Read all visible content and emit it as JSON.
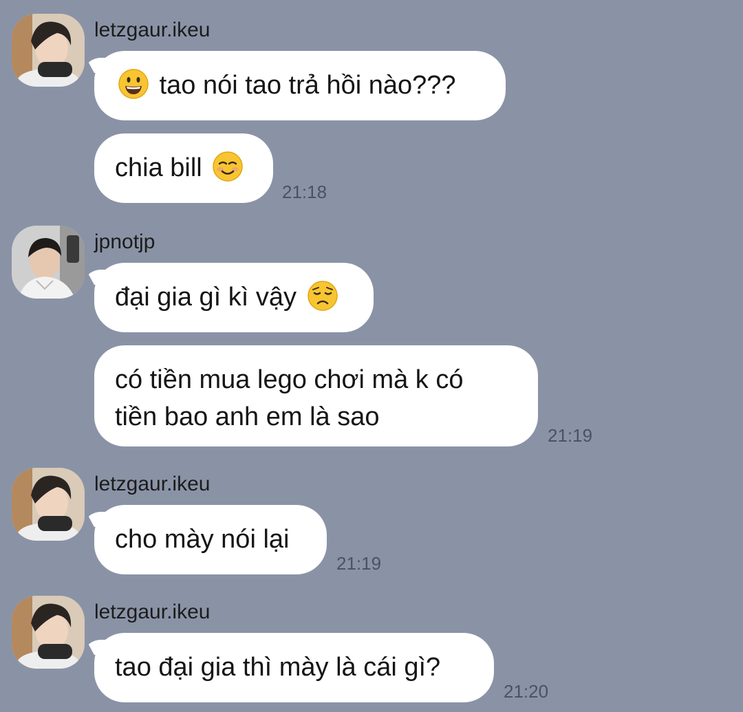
{
  "chat": {
    "groups": [
      {
        "sender": "letzgaur.ikeu",
        "messages": [
          {
            "emoji_prefix": "grinning-face",
            "text": "tao nói tao trả hồi nào???"
          },
          {
            "text": "chia bill",
            "emoji_suffix": "smiling-face"
          }
        ],
        "time": "21:18"
      },
      {
        "sender": "jpnotjp",
        "messages": [
          {
            "text": "đại gia gì kì vậy",
            "emoji_suffix": "disappointed-face"
          },
          {
            "line1": "có tiền mua lego chơi mà k có",
            "line2": "tiền bao anh em là sao"
          }
        ],
        "time": "21:19"
      },
      {
        "sender": "letzgaur.ikeu",
        "messages": [
          {
            "text": "cho mày nói lại"
          }
        ],
        "time": "21:19"
      },
      {
        "sender": "letzgaur.ikeu",
        "messages": [
          {
            "text": "tao đại gia thì mày là cái gì?"
          }
        ],
        "time": "21:20"
      }
    ]
  },
  "colors": {
    "background": "#8a93a6",
    "bubble": "#ffffff",
    "timestamp": "#4a5263"
  }
}
